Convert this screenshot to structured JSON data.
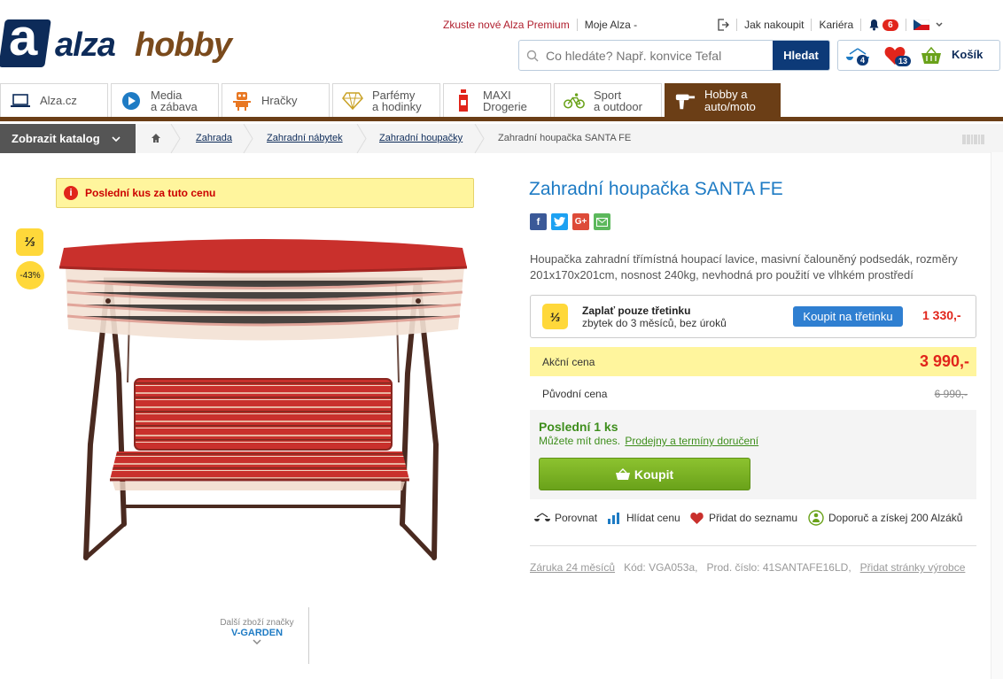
{
  "header": {
    "logo_a": "a",
    "logo_word1": "alza",
    "logo_word2": "hobby",
    "premium_link": "Zkuste nové Alza Premium",
    "my_alza": "Moje Alza -",
    "how_to_buy": "Jak nakoupit",
    "career": "Kariéra",
    "notifications_count": "6",
    "search_placeholder": "Co hledáte? Např. konvice Tefal",
    "search_button": "Hledat",
    "compare_count": "4",
    "wishlist_count": "13",
    "cart_label": "Košík"
  },
  "tabs": [
    {
      "label": "Alza.cz"
    },
    {
      "label1": "Media",
      "label2": "a zábava"
    },
    {
      "label": "Hračky"
    },
    {
      "label1": "Parfémy",
      "label2": "a hodinky"
    },
    {
      "label1": "MAXI",
      "label2": "Drogerie"
    },
    {
      "label1": "Sport",
      "label2": "a outdoor"
    },
    {
      "label1": "Hobby a",
      "label2": "auto/moto"
    }
  ],
  "breadcrumb": {
    "catalog_button": "Zobrazit katalog",
    "items": [
      "Zahrada",
      "Zahradní nábytek",
      "Zahradní houpačky",
      "Zahradní houpačka SANTA FE"
    ]
  },
  "product": {
    "warning": "Poslední kus za tuto cenu",
    "third_badge": "⅓",
    "discount_badge": "-43%",
    "brand_more": "Další zboží značky",
    "brand_name": "V-GARDEN",
    "title": "Zahradní houpačka SANTA FE",
    "description": "Houpačka zahradní třímístná houpací lavice, masivní čalouněný podsedák, rozměry 201x170x201cm, nosnost 240kg, nevhodná pro použití ve vlhkém prostředí",
    "installment_title": "Zaplať pouze třetinku",
    "installment_sub": "zbytek do 3 měsíců, bez úroků",
    "installment_button": "Koupit na třetinku",
    "installment_price": "1 330,-",
    "action_label": "Akční cena",
    "action_price": "3 990,-",
    "orig_label": "Původní cena",
    "orig_price": "6 990,-",
    "stock_title": "Poslední 1 ks",
    "stock_sub": "Můžete mít dnes.",
    "stock_link": "Prodejny a termíny doručení",
    "buy_button": "Koupit",
    "compare": "Porovnat",
    "watch_price": "Hlídat cenu",
    "add_list": "Přidat do seznamu",
    "recommend": "Doporuč a získej 200 Alzáků",
    "warranty": "Záruka 24 měsíců",
    "code": "Kód: VGA053a,",
    "product_no": "Prod. číslo: 41SANTAFE16LD,",
    "add_pages": "Přidat stránky výrobce"
  },
  "colors": {
    "brand_blue": "#0d2b59",
    "hobby_brown": "#6b3e16",
    "accent_blue": "#1e7bc4",
    "price_red": "#e1251b",
    "buy_green": "#6aa21a",
    "highlight_yellow": "#fff59d"
  }
}
